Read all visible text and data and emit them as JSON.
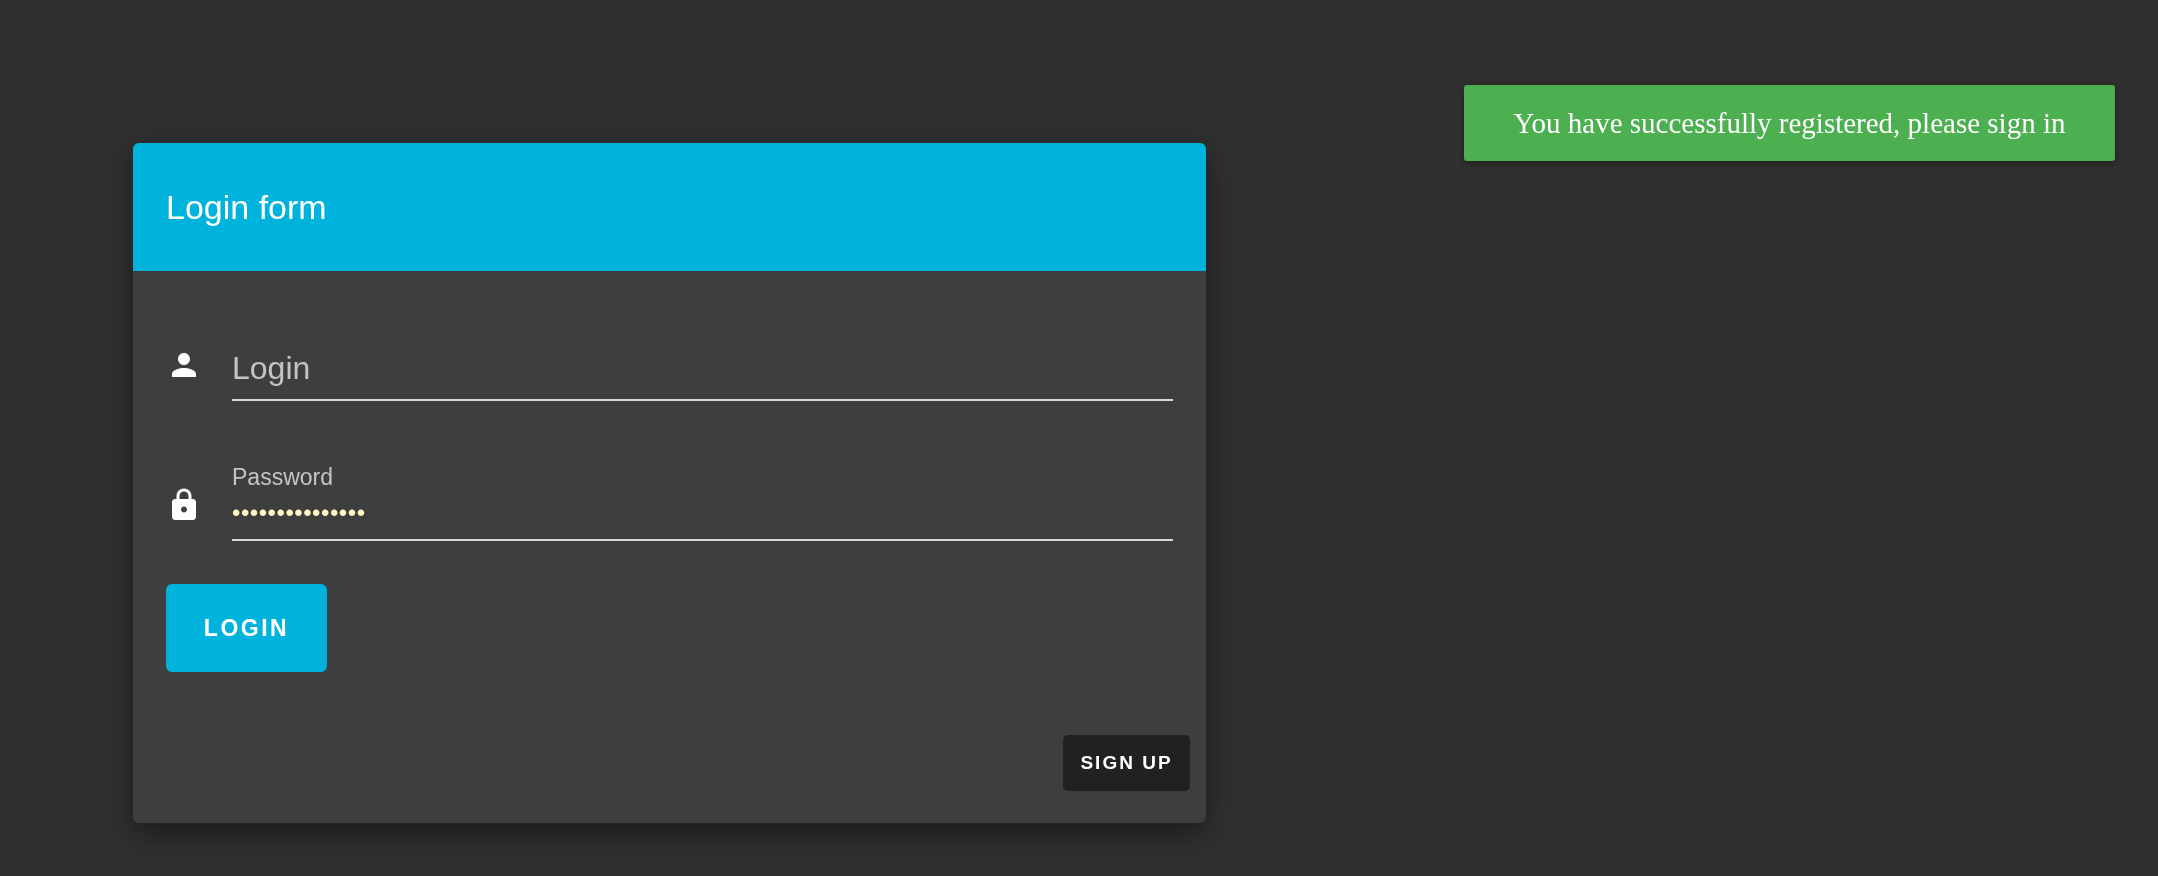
{
  "notification": {
    "message": "You have successfully registered, please sign in"
  },
  "login_form": {
    "title": "Login form",
    "fields": [
      {
        "kind": "user",
        "placeholder": "Login"
      },
      {
        "kind": "lock",
        "label": "Password",
        "value": "•••••••••••••••"
      }
    ],
    "submit_button": "LOGIN",
    "signup_button": "SIGN UP"
  }
}
